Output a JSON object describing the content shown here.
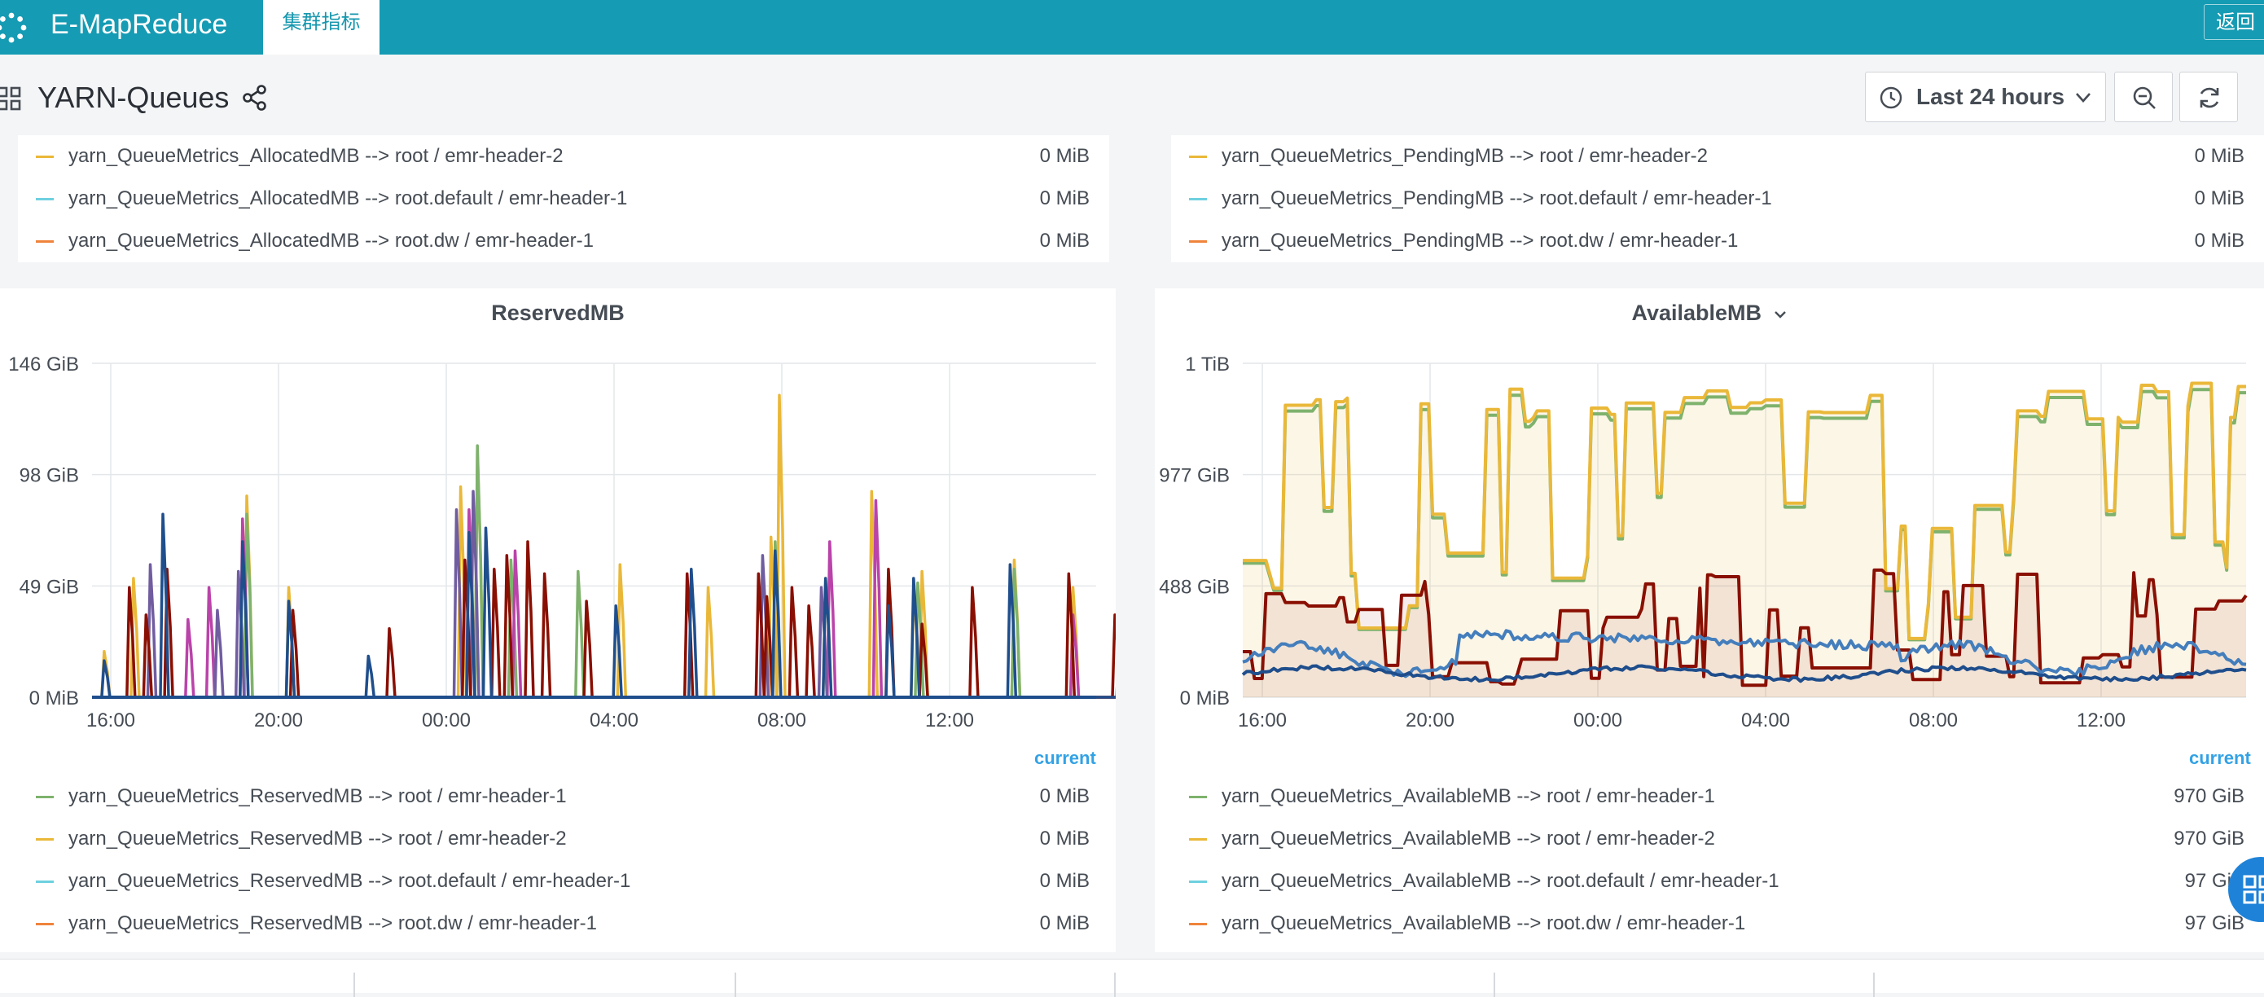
{
  "app": {
    "brand": "E-MapReduce",
    "active_tab": "集群指标",
    "back_label": "返回"
  },
  "dashboard": {
    "title": "YARN-Queues"
  },
  "toolbar": {
    "time_range": "Last 24 hours"
  },
  "colors": {
    "green": "#7eb26d",
    "yellow": "#eab839",
    "cyan": "#6ed0e0",
    "orange": "#ef843c",
    "red": "#890f02",
    "navy": "#1f4e8c",
    "blue": "#447ebc",
    "purple": "#705da0",
    "magenta": "#ba43a9"
  },
  "allocated_legend": [
    {
      "name": "yarn_QueueMetrics_AllocatedMB --> root / emr-header-2",
      "value": "0 MiB",
      "color": "#eab839"
    },
    {
      "name": "yarn_QueueMetrics_AllocatedMB --> root.default / emr-header-1",
      "value": "0 MiB",
      "color": "#6ed0e0"
    },
    {
      "name": "yarn_QueueMetrics_AllocatedMB --> root.dw / emr-header-1",
      "value": "0 MiB",
      "color": "#ef843c"
    }
  ],
  "pending_legend": [
    {
      "name": "yarn_QueueMetrics_PendingMB --> root / emr-header-2",
      "value": "0 MiB",
      "color": "#eab839"
    },
    {
      "name": "yarn_QueueMetrics_PendingMB --> root.default / emr-header-1",
      "value": "0 MiB",
      "color": "#6ed0e0"
    },
    {
      "name": "yarn_QueueMetrics_PendingMB --> root.dw / emr-header-1",
      "value": "0 MiB",
      "color": "#ef843c"
    }
  ],
  "reserved_panel": {
    "title": "ReservedMB",
    "current_label": "current",
    "legend": [
      {
        "name": "yarn_QueueMetrics_ReservedMB --> root / emr-header-1",
        "value": "0 MiB",
        "color": "#7eb26d"
      },
      {
        "name": "yarn_QueueMetrics_ReservedMB --> root / emr-header-2",
        "value": "0 MiB",
        "color": "#eab839"
      },
      {
        "name": "yarn_QueueMetrics_ReservedMB --> root.default / emr-header-1",
        "value": "0 MiB",
        "color": "#6ed0e0"
      },
      {
        "name": "yarn_QueueMetrics_ReservedMB --> root.dw / emr-header-1",
        "value": "0 MiB",
        "color": "#ef843c"
      }
    ]
  },
  "available_panel": {
    "title": "AvailableMB",
    "current_label": "current",
    "legend": [
      {
        "name": "yarn_QueueMetrics_AvailableMB --> root / emr-header-1",
        "value": "970 GiB",
        "color": "#7eb26d"
      },
      {
        "name": "yarn_QueueMetrics_AvailableMB --> root / emr-header-2",
        "value": "970 GiB",
        "color": "#eab839"
      },
      {
        "name": "yarn_QueueMetrics_AvailableMB --> root.default / emr-header-1",
        "value": "97 GiB",
        "color": "#6ed0e0"
      },
      {
        "name": "yarn_QueueMetrics_AvailableMB --> root.dw / emr-header-1",
        "value": "97 GiB",
        "color": "#ef843c"
      }
    ]
  },
  "chart_data": [
    {
      "type": "line",
      "title": "ReservedMB",
      "x_ticks": [
        "16:00",
        "20:00",
        "00:00",
        "04:00",
        "08:00",
        "12:00"
      ],
      "y_ticks": [
        "0 MiB",
        "49 GiB",
        "98 GiB",
        "146 GiB"
      ],
      "ylim": [
        0,
        146
      ],
      "unit": "GiB",
      "x_range_hours": [
        15.6,
        15.7
      ],
      "series": [
        {
          "color": "#eab839",
          "spikes": [
            [
              15.9,
              20
            ],
            [
              16.6,
              52
            ],
            [
              19.3,
              88
            ],
            [
              20.3,
              48
            ],
            [
              24.4,
              92
            ],
            [
              24.8,
              108
            ],
            [
              28.2,
              58
            ],
            [
              30.3,
              48
            ],
            [
              31.8,
              70
            ],
            [
              32.0,
              132
            ],
            [
              33.1,
              52
            ],
            [
              34.2,
              90
            ],
            [
              35.2,
              48
            ],
            [
              35.4,
              55
            ],
            [
              37.6,
              60
            ],
            [
              39.0,
              48
            ],
            [
              42.3,
              55
            ],
            [
              43.1,
              34
            ]
          ]
        },
        {
          "color": "#7eb26d",
          "spikes": [
            [
              19.3,
              80
            ],
            [
              20.3,
              42
            ],
            [
              24.8,
              110
            ],
            [
              25.6,
              60
            ],
            [
              27.2,
              55
            ],
            [
              31.9,
              68
            ],
            [
              35.3,
              50
            ],
            [
              37.6,
              56
            ]
          ]
        },
        {
          "color": "#ba43a9",
          "spikes": [
            [
              17.9,
              34
            ],
            [
              18.4,
              48
            ],
            [
              19.2,
              78
            ],
            [
              24.6,
              82
            ],
            [
              25.7,
              64
            ],
            [
              33.2,
              68
            ],
            [
              34.3,
              86
            ],
            [
              39.0,
              36
            ],
            [
              42.2,
              50
            ]
          ]
        },
        {
          "color": "#705da0",
          "spikes": [
            [
              17.0,
              58
            ],
            [
              18.6,
              38
            ],
            [
              19.1,
              55
            ],
            [
              24.3,
              82
            ],
            [
              24.7,
              90
            ],
            [
              31.6,
              62
            ],
            [
              33.0,
              48
            ]
          ]
        },
        {
          "color": "#890f02",
          "spikes": [
            [
              16.5,
              48
            ],
            [
              16.9,
              36
            ],
            [
              17.4,
              56
            ],
            [
              20.4,
              38
            ],
            [
              22.7,
              30
            ],
            [
              24.5,
              60
            ],
            [
              25.2,
              56
            ],
            [
              25.5,
              62
            ],
            [
              26.0,
              68
            ],
            [
              26.4,
              54
            ],
            [
              27.4,
              42
            ],
            [
              29.8,
              54
            ],
            [
              31.5,
              54
            ],
            [
              31.7,
              44
            ],
            [
              32.3,
              48
            ],
            [
              32.7,
              40
            ],
            [
              34.6,
              56
            ],
            [
              35.4,
              32
            ],
            [
              36.6,
              48
            ],
            [
              38.9,
              54
            ],
            [
              40.0,
              36
            ],
            [
              41.1,
              38
            ],
            [
              41.7,
              46
            ],
            [
              42.6,
              52
            ],
            [
              43.2,
              62
            ],
            [
              43.5,
              40
            ]
          ]
        },
        {
          "color": "#1f4e8c",
          "spikes": [
            [
              15.9,
              16
            ],
            [
              17.3,
              80
            ],
            [
              19.2,
              68
            ],
            [
              20.3,
              42
            ],
            [
              22.2,
              18
            ],
            [
              24.6,
              72
            ],
            [
              25.0,
              74
            ],
            [
              28.1,
              40
            ],
            [
              29.9,
              56
            ],
            [
              31.9,
              64
            ],
            [
              33.1,
              52
            ],
            [
              34.6,
              40
            ],
            [
              35.2,
              52
            ],
            [
              37.5,
              58
            ],
            [
              40.1,
              28
            ]
          ]
        }
      ]
    },
    {
      "type": "area",
      "title": "AvailableMB",
      "x_ticks": [
        "16:00",
        "20:00",
        "00:00",
        "04:00",
        "08:00",
        "12:00"
      ],
      "y_ticks": [
        "0 MiB",
        "488 GiB",
        "977 GiB",
        "1 TiB"
      ],
      "ylim": [
        0,
        1465
      ],
      "unit": "GiB",
      "series": [
        {
          "name": "root / emr-header-1",
          "color": "#7eb26d",
          "pattern": "yellow-like"
        },
        {
          "name": "root / emr-header-2",
          "color": "#eab839",
          "pattern": "high-blocks"
        },
        {
          "name": "red",
          "color": "#890f02",
          "pattern": "mid-blocks"
        },
        {
          "name": "blue",
          "color": "#447ebc",
          "pattern": "low-steps"
        },
        {
          "name": "navy",
          "color": "#1f4e8c",
          "pattern": "low-flat"
        }
      ]
    }
  ]
}
